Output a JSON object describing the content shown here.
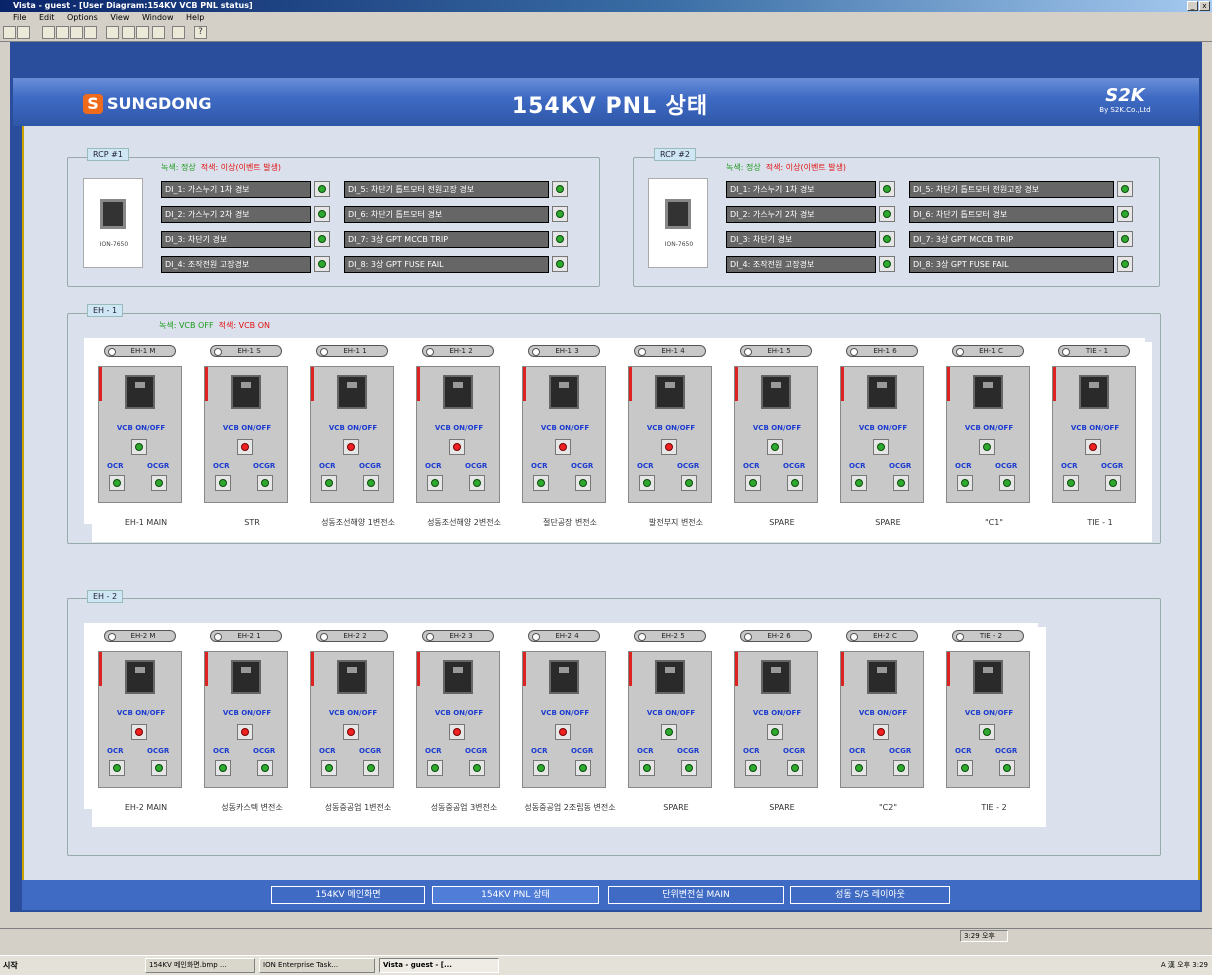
{
  "window": {
    "title": "Vista - guest - [User Diagram:154KV VCB PNL status]",
    "menu": [
      "File",
      "Edit",
      "Options",
      "View",
      "Window",
      "Help"
    ]
  },
  "toolbar": {
    "icons": [
      "open-icon",
      "save-icon",
      "zoom-icon",
      "window-icon",
      "grid-icon",
      "image-icon",
      "blank-icon",
      "cut-icon",
      "copy-icon",
      "paste-icon",
      "diagram-icon",
      "help-icon"
    ],
    "help_label": "?"
  },
  "header": {
    "logo_mark": "S",
    "logo_text": "SUNGDONG",
    "title": "154KV PNL 상태",
    "brand": "S2K",
    "brand_sub": "By S2K.Co.,Ltd"
  },
  "rcp1": {
    "label": "RCP #1",
    "legend_green": "녹색: 정상",
    "legend_red": "적색: 이상(이벤트 발생)",
    "device": "ION-7650",
    "alarms": [
      {
        "text": "DI_1: 가스누기 1차 경보",
        "state": "normal"
      },
      {
        "text": "DI_2: 가스누기 2차 경보",
        "state": "normal"
      },
      {
        "text": "DI_3: 차단기 경보",
        "state": "normal"
      },
      {
        "text": "DI_4: 조작전원 고장경보",
        "state": "normal"
      },
      {
        "text": "DI_5: 차단기 톱트모터 전원고장 경보",
        "state": "normal"
      },
      {
        "text": "DI_6: 차단기 톱트모터 경보",
        "state": "normal"
      },
      {
        "text": "DI_7: 3상 GPT MCCB TRIP",
        "state": "normal"
      },
      {
        "text": "DI_8: 3상 GPT FUSE FAIL",
        "state": "normal"
      }
    ]
  },
  "rcp2": {
    "label": "RCP #2",
    "legend_green": "녹색: 정상",
    "legend_red": "적색: 이상(이벤트 발생)",
    "device": "ION-7650",
    "alarms": [
      {
        "text": "DI_1: 가스누기 1차 경보",
        "state": "normal"
      },
      {
        "text": "DI_2: 가스누기 2차 경보",
        "state": "normal"
      },
      {
        "text": "DI_3: 차단기 경보",
        "state": "normal"
      },
      {
        "text": "DI_4: 조작전원 고장경보",
        "state": "normal"
      },
      {
        "text": "DI_5: 차단기 톱트모터 전원고장 경보",
        "state": "normal"
      },
      {
        "text": "DI_6: 차단기 톱트모터 경보",
        "state": "normal"
      },
      {
        "text": "DI_7: 3상 GPT MCCB TRIP",
        "state": "normal"
      },
      {
        "text": "DI_8: 3상 GPT FUSE FAIL",
        "state": "normal"
      }
    ]
  },
  "labels": {
    "vcb": "VCB ON/OFF",
    "ocr": "OCR",
    "ocgr": "OCGR"
  },
  "eh1": {
    "label": "EH - 1",
    "legend_green": "녹색: VCB OFF",
    "legend_red": "적색: VCB ON",
    "panels": [
      {
        "tag": "EH-1 M",
        "name": "EH-1 MAIN",
        "vcb": "off"
      },
      {
        "tag": "EH-1 S",
        "name": "STR",
        "vcb": "on"
      },
      {
        "tag": "EH-1 1",
        "name": "성동조선해양 1변전소",
        "vcb": "on"
      },
      {
        "tag": "EH-1 2",
        "name": "성동조선해양 2변전소",
        "vcb": "on"
      },
      {
        "tag": "EH-1 3",
        "name": "절단공장 변전소",
        "vcb": "on"
      },
      {
        "tag": "EH-1 4",
        "name": "발전부지 변전소",
        "vcb": "on"
      },
      {
        "tag": "EH-1 5",
        "name": "SPARE",
        "vcb": "off"
      },
      {
        "tag": "EH-1 6",
        "name": "SPARE",
        "vcb": "off"
      },
      {
        "tag": "EH-1 C",
        "name": "\"C1\"",
        "vcb": "off"
      },
      {
        "tag": "TIE - 1",
        "name": "TIE - 1",
        "vcb": "on"
      }
    ]
  },
  "eh2": {
    "label": "EH - 2",
    "panels": [
      {
        "tag": "EH-2 M",
        "name": "EH-2 MAIN",
        "vcb": "on"
      },
      {
        "tag": "EH-2 1",
        "name": "성동카스텍 변전소",
        "vcb": "on"
      },
      {
        "tag": "EH-2 2",
        "name": "성동중공업 1변전소",
        "vcb": "on"
      },
      {
        "tag": "EH-2 3",
        "name": "성동중공업 3변전소",
        "vcb": "on"
      },
      {
        "tag": "EH-2 4",
        "name": "성동중공업 2조립동 변전소",
        "vcb": "on"
      },
      {
        "tag": "EH-2 5",
        "name": "SPARE",
        "vcb": "off"
      },
      {
        "tag": "EH-2 6",
        "name": "SPARE",
        "vcb": "off"
      },
      {
        "tag": "EH-2 C",
        "name": "\"C2\"",
        "vcb": "on"
      },
      {
        "tag": "TIE - 2",
        "name": "TIE - 2",
        "vcb": "off"
      }
    ]
  },
  "nav": [
    {
      "label": "154KV 메인화면"
    },
    {
      "label": "154KV PNL 상태",
      "active": true
    },
    {
      "label": "단위변전실 MAIN"
    },
    {
      "label": "성동 S/S 레이아웃"
    }
  ],
  "statusbar": {
    "time": "3:29 오후"
  },
  "taskbar": {
    "start": "시작",
    "tasks": [
      "154KV 메인화면.bmp ...",
      "ION Enterprise Task...",
      "Vista - guest - [..."
    ],
    "tray": "A 漢 오후 3:29"
  },
  "colors": {
    "header": "#3f6bc4",
    "content_bg": "#dbe1ec",
    "lamp_normal": "#2fa82f",
    "lamp_alarm": "#e22222",
    "label_blue": "#1a3bd0"
  }
}
